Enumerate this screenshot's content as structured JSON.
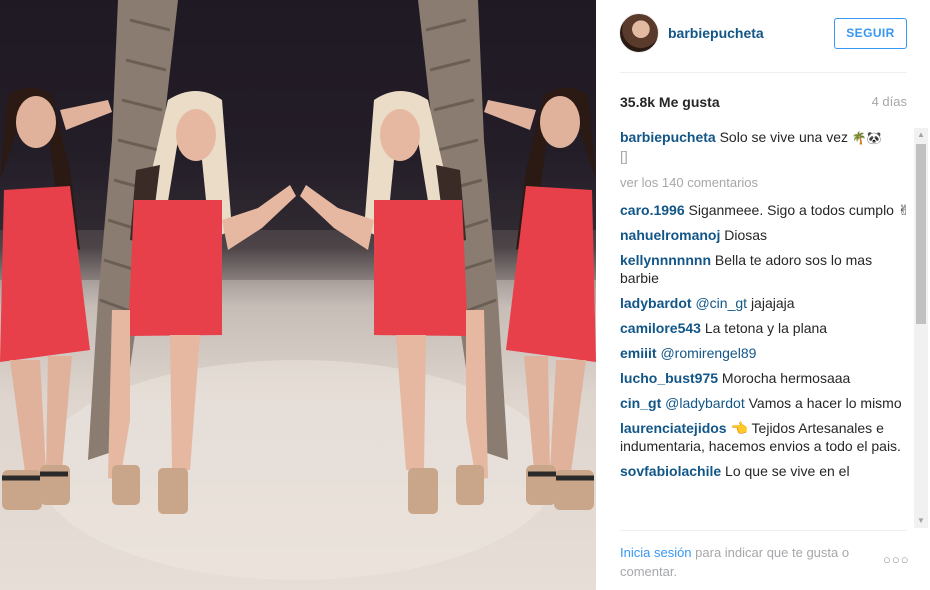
{
  "header": {
    "username": "barbiepucheta",
    "follow_label": "SEGUIR"
  },
  "stats": {
    "likes": "35.8k Me gusta",
    "time": "4 días"
  },
  "caption": {
    "user": "barbiepucheta",
    "text": "Solo se vive una vez",
    "emoji": "🌴🐼",
    "bracket": "[]"
  },
  "view_all_comments": "ver los 140 comentarios",
  "comments": [
    {
      "user": "caro.1996",
      "text": "Siganmeee. Sigo a todos cumplo ✌"
    },
    {
      "user": "nahuelromanoj",
      "text": "Diosas"
    },
    {
      "user": "kellynnnnnnn",
      "text": "Bella te adoro sos lo mas barbie"
    },
    {
      "user": "ladybardot",
      "mention": "@cin_gt",
      "text": "jajajaja"
    },
    {
      "user": "camilore543",
      "text": "La tetona y la plana"
    },
    {
      "user": "emiiit",
      "mention": "@romirengel89",
      "text": ""
    },
    {
      "user": "lucho_bust975",
      "text": "Morocha hermosaaa"
    },
    {
      "user": "cin_gt",
      "mention": "@ladybardot",
      "text": "Vamos a hacer lo mismo"
    },
    {
      "user": "laurenciatejidos",
      "text": "👈 Tejidos Artesanales e indumentaria, hacemos envios a todo el pais."
    },
    {
      "user": "sovfabiolachile",
      "text": "Lo que se vive en el"
    }
  ],
  "footer": {
    "login_link": "Inicia sesión",
    "login_text": " para indicar que te gusta o comentar.",
    "more": "○○○"
  },
  "colors": {
    "username_blue": "#125688",
    "accent_blue": "#3897f0",
    "muted_gray": "#a5a7aa",
    "dress_red": "#e8404a"
  },
  "icons": {
    "scroll_up": "▲",
    "scroll_down": "▼"
  }
}
